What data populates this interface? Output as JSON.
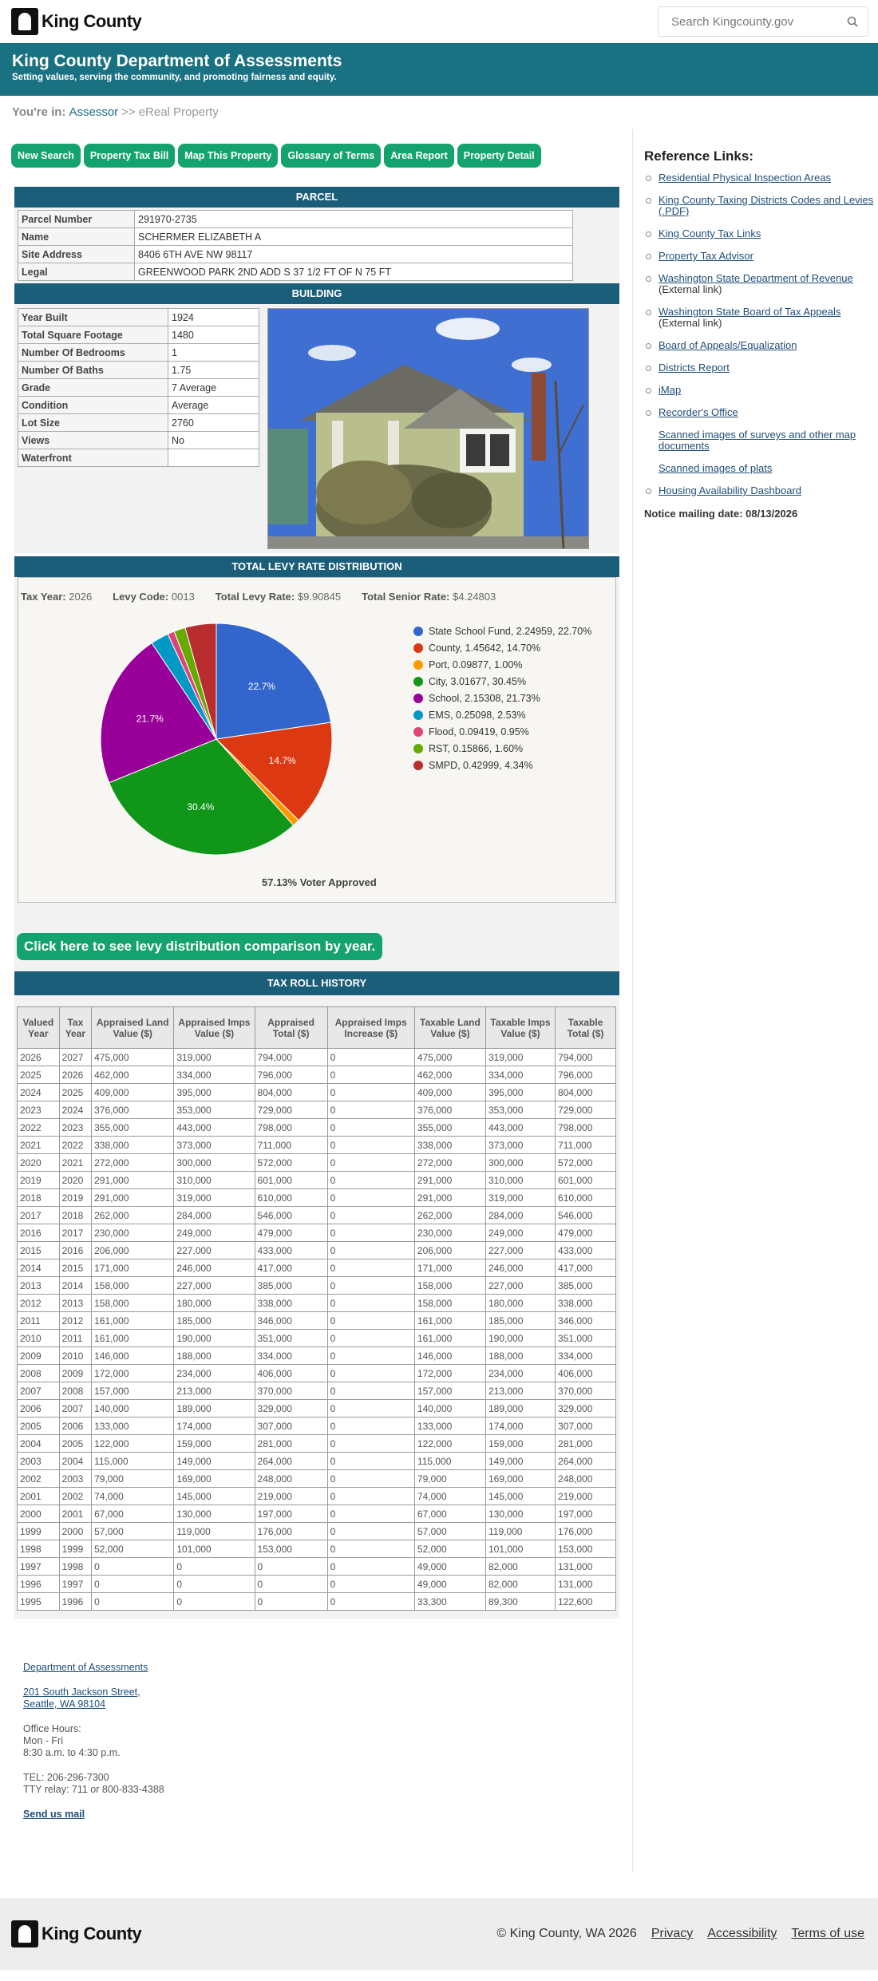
{
  "header": {
    "logo_text": "King County",
    "search_placeholder": "Search Kingcounty.gov"
  },
  "banner": {
    "title": "King County Department of Assessments",
    "tagline": "Setting values, serving the community, and promoting fairness and equity."
  },
  "breadcrumb": {
    "prefix": "You're in:",
    "link": "Assessor",
    "sep": ">>",
    "current": "eReal Property"
  },
  "nav_buttons": [
    "New Search",
    "Property Tax Bill",
    "Map This Property",
    "Glossary of Terms",
    "Area Report",
    "Property Detail"
  ],
  "parcel": {
    "title": "PARCEL",
    "rows": [
      {
        "k": "Parcel Number",
        "v": "291970-2735"
      },
      {
        "k": "Name",
        "v": "SCHERMER ELIZABETH A"
      },
      {
        "k": "Site Address",
        "v": "8406 6TH AVE NW 98117"
      },
      {
        "k": "Legal",
        "v": "GREENWOOD PARK 2ND ADD S 37 1/2 FT OF N 75 FT"
      }
    ]
  },
  "building": {
    "title": "BUILDING",
    "rows": [
      {
        "k": "Year Built",
        "v": "1924"
      },
      {
        "k": "Total Square Footage",
        "v": "1480"
      },
      {
        "k": "Number Of Bedrooms",
        "v": "1"
      },
      {
        "k": "Number Of Baths",
        "v": "1.75"
      },
      {
        "k": "Grade",
        "v": "7 Average"
      },
      {
        "k": "Condition",
        "v": "Average"
      },
      {
        "k": "Lot Size",
        "v": "2760"
      },
      {
        "k": "Views",
        "v": "No"
      },
      {
        "k": "Waterfront",
        "v": ""
      }
    ]
  },
  "levy": {
    "title": "TOTAL LEVY RATE DISTRIBUTION",
    "tax_year_label": "Tax Year:",
    "tax_year": "2026",
    "levy_code_label": "Levy Code:",
    "levy_code": "0013",
    "total_rate_label": "Total Levy Rate:",
    "total_rate": "$9.90845",
    "senior_rate_label": "Total Senior Rate:",
    "senior_rate": "$4.24803",
    "voter_approved": "57.13% Voter Approved",
    "compare_button": "Click here to see levy distribution comparison by year."
  },
  "chart_data": {
    "type": "pie",
    "slices": [
      {
        "name": "State School Fund",
        "rate": "2.24959",
        "pct": 22.7,
        "color": "#3366cc",
        "label": "22.7%"
      },
      {
        "name": "County",
        "rate": "1.45642",
        "pct": 14.7,
        "color": "#dc3912",
        "label": "14.7%"
      },
      {
        "name": "Port",
        "rate": "0.09877",
        "pct": 1.0,
        "color": "#ff9900",
        "label": ""
      },
      {
        "name": "City",
        "rate": "3.01677",
        "pct": 30.45,
        "color": "#109618",
        "label": "30.4%"
      },
      {
        "name": "School",
        "rate": "2.15308",
        "pct": 21.73,
        "color": "#990099",
        "label": "21.7%"
      },
      {
        "name": "EMS",
        "rate": "0.25098",
        "pct": 2.53,
        "color": "#0099c6",
        "label": ""
      },
      {
        "name": "Flood",
        "rate": "0.09419",
        "pct": 0.95,
        "color": "#dd4477",
        "label": ""
      },
      {
        "name": "RST",
        "rate": "0.15866",
        "pct": 1.6,
        "color": "#66aa00",
        "label": ""
      },
      {
        "name": "SMPD",
        "rate": "0.42999",
        "pct": 4.34,
        "color": "#b82e2e",
        "label": ""
      }
    ]
  },
  "tax_roll": {
    "title": "TAX ROLL HISTORY",
    "headers": [
      "Valued Year",
      "Tax Year",
      "Appraised Land Value ($)",
      "Appraised Imps Value ($)",
      "Appraised Total ($)",
      "Appraised Imps Increase ($)",
      "Taxable Land Value ($)",
      "Taxable Imps Value ($)",
      "Taxable Total ($)"
    ],
    "rows": [
      [
        "2026",
        "2027",
        "475,000",
        "319,000",
        "794,000",
        "0",
        "475,000",
        "319,000",
        "794,000"
      ],
      [
        "2025",
        "2026",
        "462,000",
        "334,000",
        "796,000",
        "0",
        "462,000",
        "334,000",
        "796,000"
      ],
      [
        "2024",
        "2025",
        "409,000",
        "395,000",
        "804,000",
        "0",
        "409,000",
        "395,000",
        "804,000"
      ],
      [
        "2023",
        "2024",
        "376,000",
        "353,000",
        "729,000",
        "0",
        "376,000",
        "353,000",
        "729,000"
      ],
      [
        "2022",
        "2023",
        "355,000",
        "443,000",
        "798,000",
        "0",
        "355,000",
        "443,000",
        "798,000"
      ],
      [
        "2021",
        "2022",
        "338,000",
        "373,000",
        "711,000",
        "0",
        "338,000",
        "373,000",
        "711,000"
      ],
      [
        "2020",
        "2021",
        "272,000",
        "300,000",
        "572,000",
        "0",
        "272,000",
        "300,000",
        "572,000"
      ],
      [
        "2019",
        "2020",
        "291,000",
        "310,000",
        "601,000",
        "0",
        "291,000",
        "310,000",
        "601,000"
      ],
      [
        "2018",
        "2019",
        "291,000",
        "319,000",
        "610,000",
        "0",
        "291,000",
        "319,000",
        "610,000"
      ],
      [
        "2017",
        "2018",
        "262,000",
        "284,000",
        "546,000",
        "0",
        "262,000",
        "284,000",
        "546,000"
      ],
      [
        "2016",
        "2017",
        "230,000",
        "249,000",
        "479,000",
        "0",
        "230,000",
        "249,000",
        "479,000"
      ],
      [
        "2015",
        "2016",
        "206,000",
        "227,000",
        "433,000",
        "0",
        "206,000",
        "227,000",
        "433,000"
      ],
      [
        "2014",
        "2015",
        "171,000",
        "246,000",
        "417,000",
        "0",
        "171,000",
        "246,000",
        "417,000"
      ],
      [
        "2013",
        "2014",
        "158,000",
        "227,000",
        "385,000",
        "0",
        "158,000",
        "227,000",
        "385,000"
      ],
      [
        "2012",
        "2013",
        "158,000",
        "180,000",
        "338,000",
        "0",
        "158,000",
        "180,000",
        "338,000"
      ],
      [
        "2011",
        "2012",
        "161,000",
        "185,000",
        "346,000",
        "0",
        "161,000",
        "185,000",
        "346,000"
      ],
      [
        "2010",
        "2011",
        "161,000",
        "190,000",
        "351,000",
        "0",
        "161,000",
        "190,000",
        "351,000"
      ],
      [
        "2009",
        "2010",
        "146,000",
        "188,000",
        "334,000",
        "0",
        "146,000",
        "188,000",
        "334,000"
      ],
      [
        "2008",
        "2009",
        "172,000",
        "234,000",
        "406,000",
        "0",
        "172,000",
        "234,000",
        "406,000"
      ],
      [
        "2007",
        "2008",
        "157,000",
        "213,000",
        "370,000",
        "0",
        "157,000",
        "213,000",
        "370,000"
      ],
      [
        "2006",
        "2007",
        "140,000",
        "189,000",
        "329,000",
        "0",
        "140,000",
        "189,000",
        "329,000"
      ],
      [
        "2005",
        "2006",
        "133,000",
        "174,000",
        "307,000",
        "0",
        "133,000",
        "174,000",
        "307,000"
      ],
      [
        "2004",
        "2005",
        "122,000",
        "159,000",
        "281,000",
        "0",
        "122,000",
        "159,000",
        "281,000"
      ],
      [
        "2003",
        "2004",
        "115,000",
        "149,000",
        "264,000",
        "0",
        "115,000",
        "149,000",
        "264,000"
      ],
      [
        "2002",
        "2003",
        "79,000",
        "169,000",
        "248,000",
        "0",
        "79,000",
        "169,000",
        "248,000"
      ],
      [
        "2001",
        "2002",
        "74,000",
        "145,000",
        "219,000",
        "0",
        "74,000",
        "145,000",
        "219,000"
      ],
      [
        "2000",
        "2001",
        "67,000",
        "130,000",
        "197,000",
        "0",
        "67,000",
        "130,000",
        "197,000"
      ],
      [
        "1999",
        "2000",
        "57,000",
        "119,000",
        "176,000",
        "0",
        "57,000",
        "119,000",
        "176,000"
      ],
      [
        "1998",
        "1999",
        "52,000",
        "101,000",
        "153,000",
        "0",
        "52,000",
        "101,000",
        "153,000"
      ],
      [
        "1997",
        "1998",
        "0",
        "0",
        "0",
        "0",
        "49,000",
        "82,000",
        "131,000"
      ],
      [
        "1996",
        "1997",
        "0",
        "0",
        "0",
        "0",
        "49,000",
        "82,000",
        "131,000"
      ],
      [
        "1995",
        "1996",
        "0",
        "0",
        "0",
        "0",
        "33,300",
        "89,300",
        "122,600"
      ]
    ]
  },
  "sidebar": {
    "title": "Reference Links:",
    "links": [
      {
        "text": "Residential Physical Inspection Areas",
        "ext": "",
        "bullet": true
      },
      {
        "text": "King County Taxing Districts Codes and Levies (.PDF)",
        "ext": "",
        "bullet": true
      },
      {
        "text": "King County Tax Links",
        "ext": "",
        "bullet": true
      },
      {
        "text": "Property Tax Advisor",
        "ext": "",
        "bullet": true
      },
      {
        "text": "Washington State Department of Revenue",
        "ext": " (External link)",
        "bullet": true
      },
      {
        "text": "Washington State Board of Tax Appeals",
        "ext": " (External link)",
        "bullet": true
      },
      {
        "text": "Board of Appeals/Equalization",
        "ext": "",
        "bullet": true
      },
      {
        "text": "Districts Report",
        "ext": "",
        "bullet": true
      },
      {
        "text": "iMap",
        "ext": "",
        "bullet": true
      },
      {
        "text": "Recorder's Office",
        "ext": "",
        "bullet": true
      },
      {
        "text": "Scanned images of surveys and other map documents",
        "ext": "",
        "bullet": false
      },
      {
        "text": "Scanned images of plats",
        "ext": "",
        "bullet": false
      },
      {
        "text": "Housing Availability Dashboard",
        "ext": "",
        "bullet": true
      }
    ],
    "notice": "Notice mailing date: 08/13/2026"
  },
  "office": {
    "dept": "Department of Assessments",
    "addr1": "201 South Jackson Street,",
    "addr2": "Seattle, WA 98104",
    "hours_label": "Office Hours:",
    "days": "Mon - Fri",
    "hours": "8:30 a.m. to 4:30 p.m.",
    "tel": "TEL: 206-296-7300",
    "tty": "TTY relay: 711 or 800-833-4388",
    "mail": "Send us mail"
  },
  "footer": {
    "logo_text": "King County",
    "copyright": "© King County, WA 2026",
    "privacy": "Privacy",
    "accessibility": "Accessibility",
    "terms": "Terms of use"
  }
}
